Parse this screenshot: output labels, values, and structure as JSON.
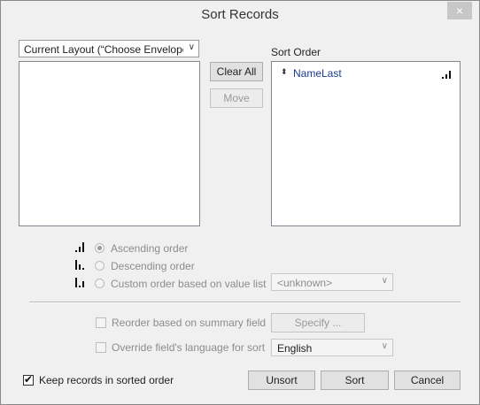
{
  "window": {
    "title": "Sort Records",
    "close_glyph": "×"
  },
  "layout_dropdown": {
    "value": "Current Layout (“Choose Envelope"
  },
  "buttons": {
    "clear_all": "Clear All",
    "move": "Move",
    "specify": "Specify ...",
    "unsort": "Unsort",
    "sort": "Sort",
    "cancel": "Cancel"
  },
  "sort_order": {
    "label": "Sort Order",
    "items": [
      {
        "field": "NameLast",
        "direction_icon": "ascending-bars-icon"
      }
    ]
  },
  "order_options": {
    "ascending": "Ascending order",
    "descending": "Descending order",
    "custom": "Custom order based on value list",
    "value_list": "<unknown>",
    "selected": "ascending"
  },
  "options": {
    "reorder_summary": "Reorder based on summary field",
    "override_language": "Override field's language for sort",
    "language": "English",
    "keep_sorted": "Keep records in sorted order",
    "keep_sorted_checked": true
  }
}
